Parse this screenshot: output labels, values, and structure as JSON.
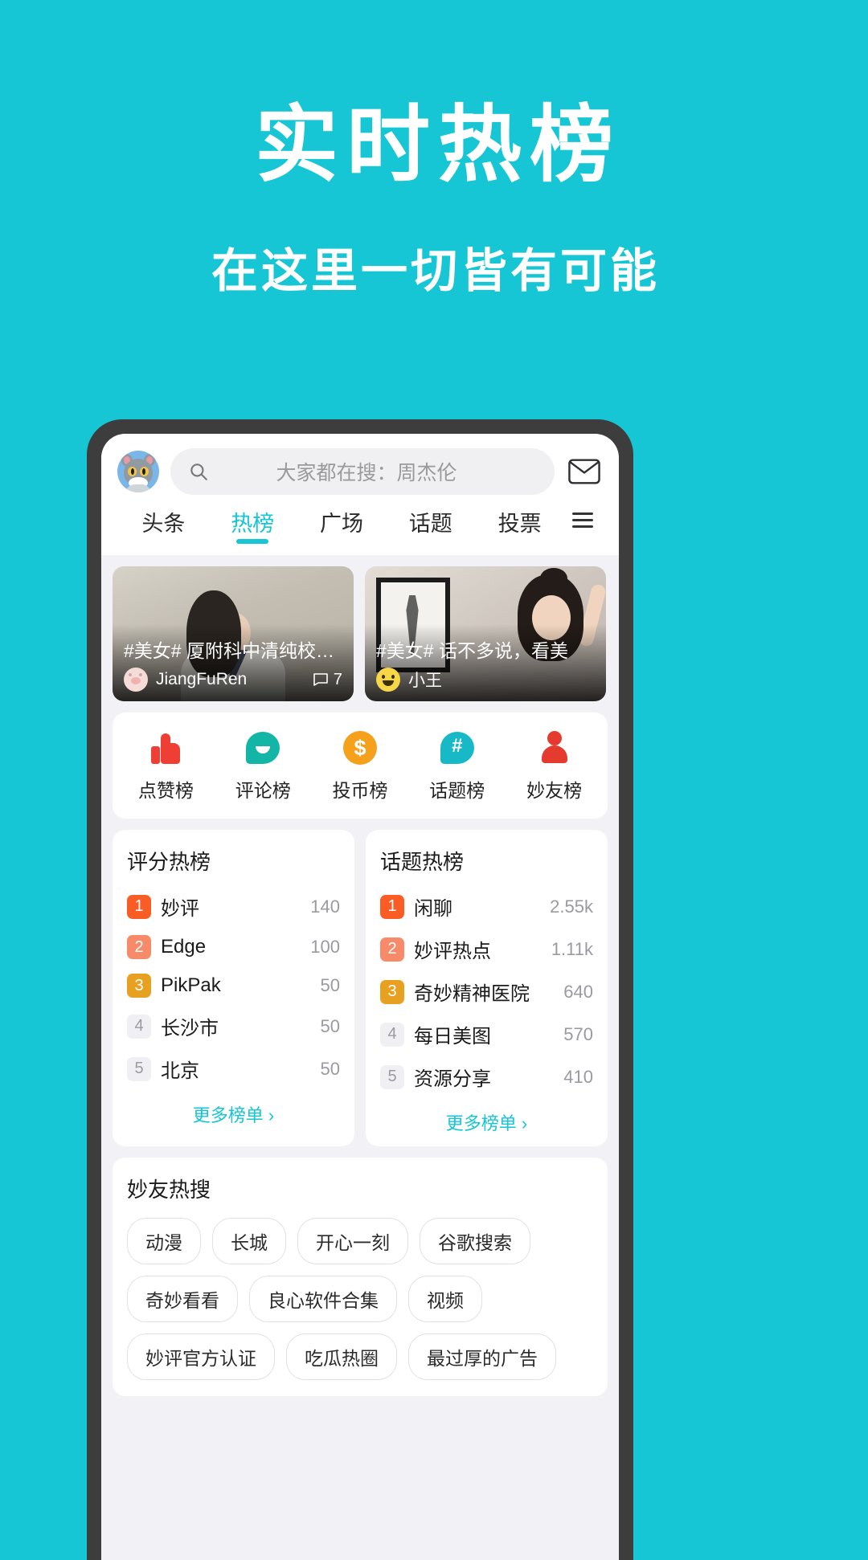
{
  "promo": {
    "title": "实时热榜",
    "subtitle": "在这里一切皆有可能"
  },
  "colors": {
    "background": "#16c6d4",
    "accent": "#16c6d4",
    "phone_frame": "#3d3d3d",
    "rank1": "#f95d25",
    "rank2": "#f78a68",
    "rank3": "#e8a021"
  },
  "app": {
    "search": {
      "placeholder": "大家都在搜：周杰伦",
      "search_icon": "search-icon",
      "mail_icon": "mail-icon",
      "avatar_icon": "tom-cat-avatar"
    },
    "tabs": [
      {
        "label": "头条",
        "active": false
      },
      {
        "label": "热榜",
        "active": true
      },
      {
        "label": "广场",
        "active": false
      },
      {
        "label": "话题",
        "active": false
      },
      {
        "label": "投票",
        "active": false
      }
    ],
    "menu_icon": "hamburger-menu-icon",
    "cards": [
      {
        "title": "#美女# 厦附科中清纯校花，学校表白…",
        "user": "JiangFuRen",
        "comments": "7",
        "comment_icon": "comment-icon",
        "avatar_icon": "pig-face-avatar"
      },
      {
        "title": "#美女# 话不多说，看美",
        "user": "小王",
        "comments": "",
        "comment_icon": "comment-icon",
        "avatar_icon": "smiley-face-avatar"
      }
    ],
    "quick_icons": [
      {
        "label": "点赞榜",
        "icon": "thumbs-up-icon",
        "color": "#ef3e33"
      },
      {
        "label": "评论榜",
        "icon": "comment-bubble-icon",
        "color": "#13b5a6"
      },
      {
        "label": "投币榜",
        "icon": "coin-dollar-icon",
        "color": "#f5a11c"
      },
      {
        "label": "话题榜",
        "icon": "hashtag-bubble-icon",
        "color": "#17b9c6"
      },
      {
        "label": "妙友榜",
        "icon": "person-icon",
        "color": "#e53b2f"
      }
    ],
    "rank_lists": [
      {
        "title": "评分热榜",
        "more_label": "更多榜单",
        "more_icon": "chevron-right-icon",
        "rows": [
          {
            "rank": "1",
            "name": "妙评",
            "value": "140"
          },
          {
            "rank": "2",
            "name": "Edge",
            "value": "100"
          },
          {
            "rank": "3",
            "name": "PikPak",
            "value": "50"
          },
          {
            "rank": "4",
            "name": "长沙市",
            "value": "50"
          },
          {
            "rank": "5",
            "name": "北京",
            "value": "50"
          }
        ]
      },
      {
        "title": "话题热榜",
        "more_label": "更多榜单",
        "more_icon": "chevron-right-icon",
        "rows": [
          {
            "rank": "1",
            "name": "闲聊",
            "value": "2.55k"
          },
          {
            "rank": "2",
            "name": "妙评热点",
            "value": "1.11k"
          },
          {
            "rank": "3",
            "name": "奇妙精神医院",
            "value": "640"
          },
          {
            "rank": "4",
            "name": "每日美图",
            "value": "570"
          },
          {
            "rank": "5",
            "name": "资源分享",
            "value": "410"
          }
        ]
      }
    ],
    "hot_search": {
      "title": "妙友热搜",
      "tags": [
        "动漫",
        "长城",
        "开心一刻",
        "谷歌搜索",
        "奇妙看看",
        "良心软件合集",
        "视频",
        "妙评官方认证",
        "吃瓜热圈",
        "最过厚的广告"
      ]
    }
  }
}
